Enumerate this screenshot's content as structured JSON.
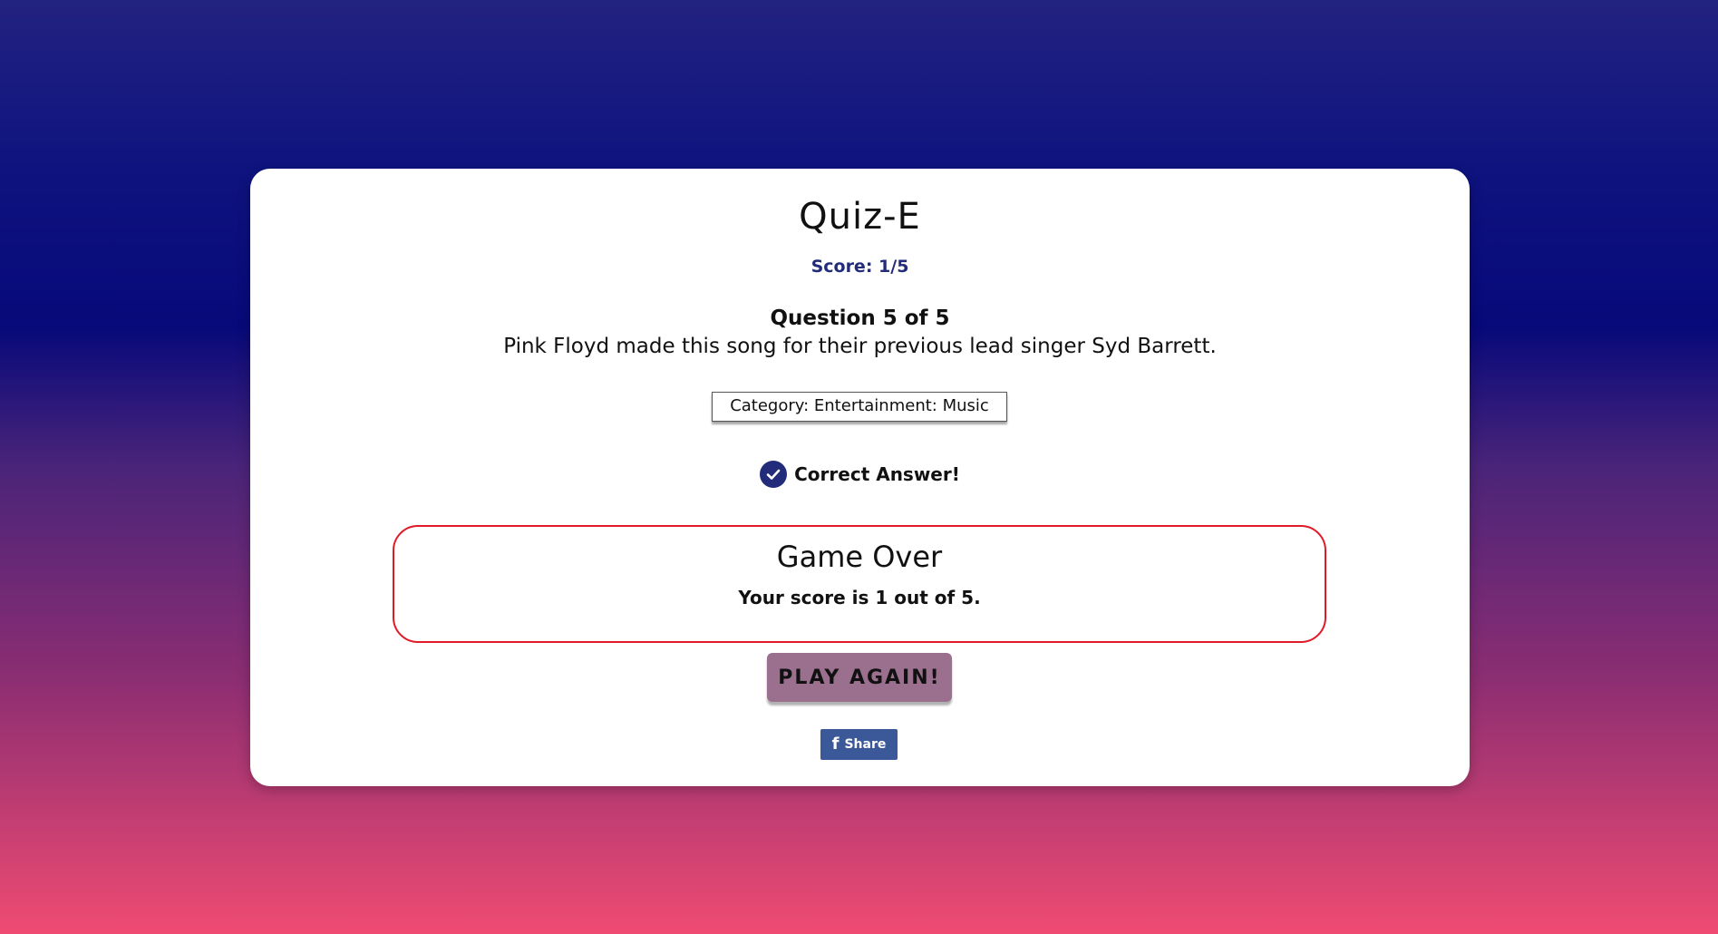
{
  "app": {
    "title": "Quiz-E",
    "score_label": "Score: 1/5"
  },
  "question": {
    "number_label": "Question 5 of 5",
    "text": "Pink Floyd made this song for their previous lead singer Syd Barrett.",
    "category": "Category: Entertainment: Music"
  },
  "feedback": {
    "text": "Correct Answer!",
    "icon": "check-circle-icon"
  },
  "game_over": {
    "title": "Game Over",
    "message": "Your score is 1 out of 5."
  },
  "actions": {
    "play_again_label": "PLAY AGAIN!",
    "share_label": "Share",
    "share_icon": "facebook-icon"
  },
  "colors": {
    "accent": "#232c7a",
    "game_over_border": "#e01a27",
    "play_button": "#9b6f8e",
    "facebook": "#3b5998"
  }
}
